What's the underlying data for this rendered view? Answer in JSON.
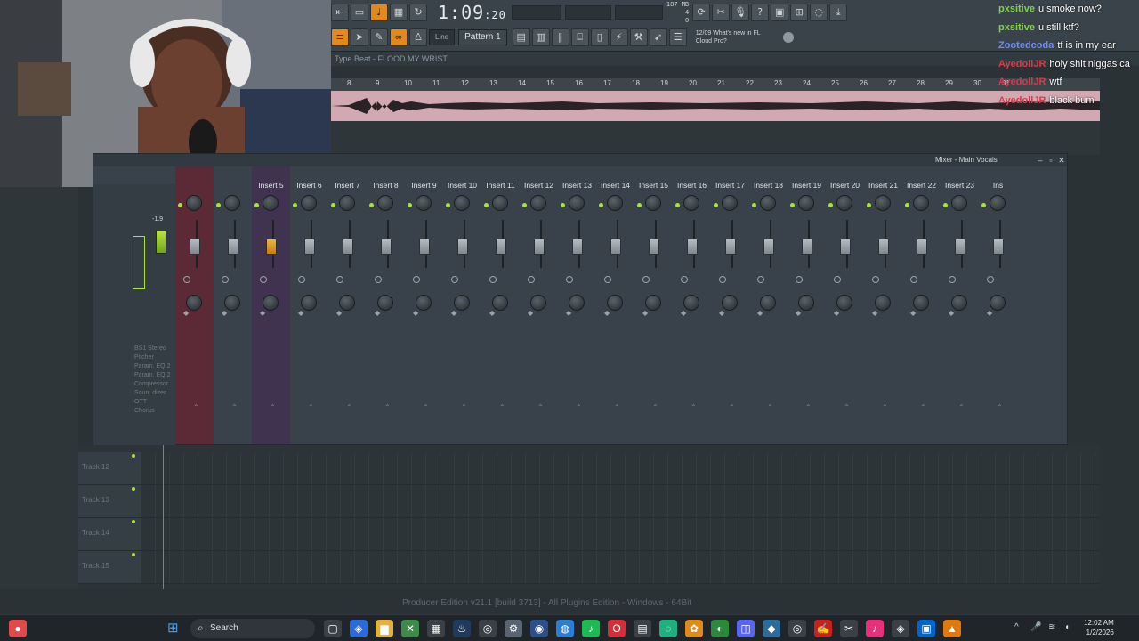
{
  "toolbar": {
    "time_main": "1:09",
    "time_sub": ":20",
    "cpu_mb": "187 MB",
    "cpu_num": "4",
    "cpu_zero": "0",
    "mode_select": "Line",
    "pattern": "Pattern 1",
    "news_date": "12/09",
    "news_line1": "What's new in FL",
    "news_line2": "Cloud Pro?"
  },
  "playlist": {
    "song_title": "Type Beat - FLOOD MY WRIST",
    "ticks": [
      "8",
      "9",
      "10",
      "11",
      "12",
      "13",
      "14",
      "15",
      "16",
      "17",
      "18",
      "19",
      "20",
      "21",
      "22",
      "23",
      "24",
      "25",
      "26",
      "27",
      "28",
      "29",
      "30",
      "31"
    ]
  },
  "chat": [
    {
      "user": "pxsitive",
      "msg": "u smoke now?",
      "color": "#7cd34a"
    },
    {
      "user": "pxsitive",
      "msg": "u still ktf?",
      "color": "#7cd34a"
    },
    {
      "user": "Zootedcoda",
      "msg": "tf is in my ear",
      "color": "#6d8cf0"
    },
    {
      "user": "AyedollJR",
      "msg": "holy shit niggas ca",
      "color": "#d83a4a"
    },
    {
      "user": "AyedollJR",
      "msg": "wtf",
      "color": "#d83a4a"
    },
    {
      "user": "AyedollJR",
      "msg": "black bum",
      "color": "#d83a4a"
    }
  ],
  "mixer": {
    "title": "Mixer - Main Vocals",
    "master_value": "-1.9",
    "fx_chain": [
      "BS1 Stereo",
      "Pitcher",
      "Param. EQ 2",
      "Param. EQ 2",
      "Compressor",
      "Soun. dizer",
      "OTT",
      "Chorus"
    ],
    "inserts": [
      "Insert 5",
      "Insert 6",
      "Insert 7",
      "Insert 8",
      "Insert 9",
      "Insert 10",
      "Insert 11",
      "Insert 12",
      "Insert 13",
      "Insert 14",
      "Insert 15",
      "Insert 16",
      "Insert 17",
      "Insert 18",
      "Insert 19",
      "Insert 20",
      "Insert 21",
      "Insert 22",
      "Insert 23",
      "Ins"
    ]
  },
  "tracks": [
    "Track 12",
    "Track 13",
    "Track 14",
    "Track 15"
  ],
  "status": "Producer Edition v21.1 [build 3713] - All Plugins Edition - Windows - 64Bit",
  "taskbar": {
    "search_label": "Search",
    "time": "12:02 AM",
    "date": "1/2/2026"
  }
}
